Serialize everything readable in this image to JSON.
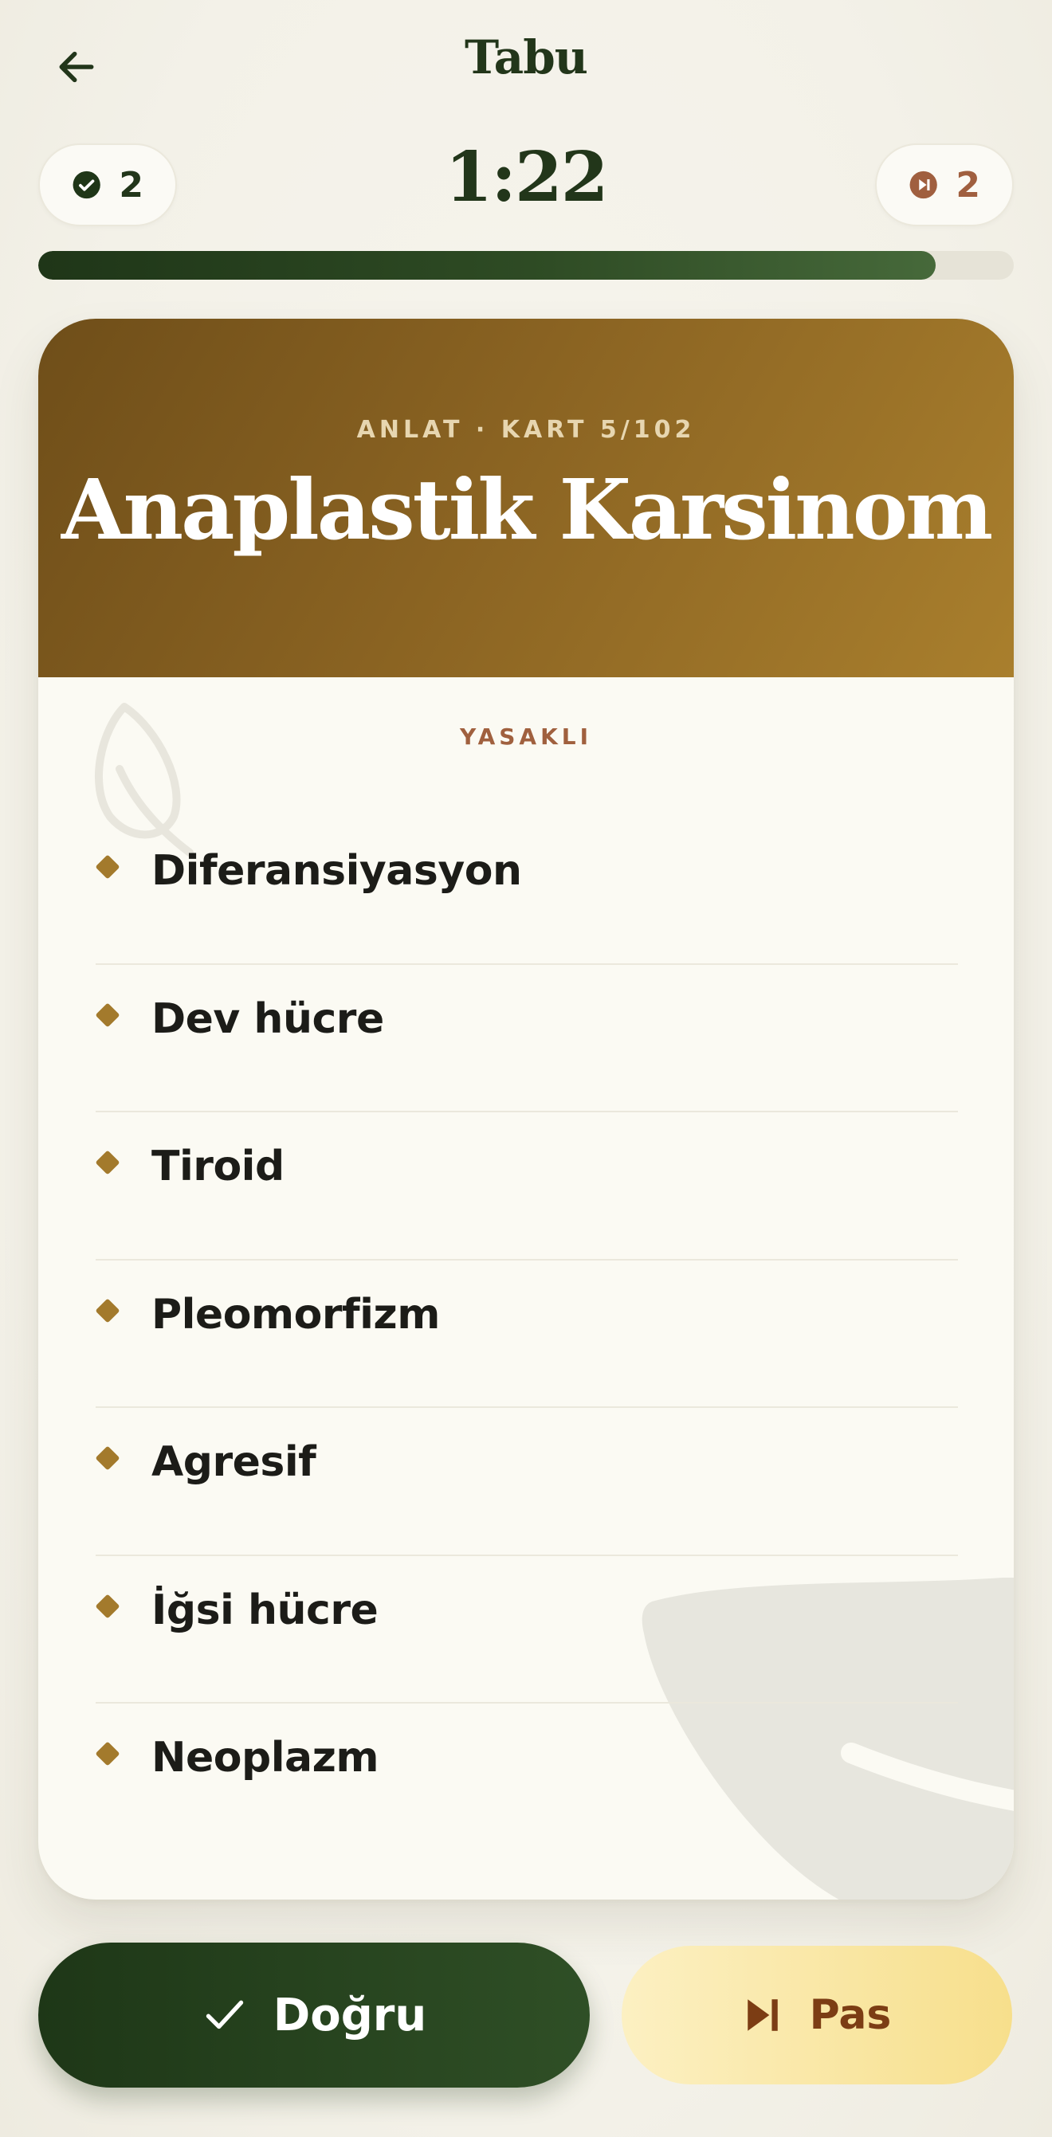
{
  "header": {
    "title": "Tabu",
    "timer": "1:22"
  },
  "score": {
    "correct_count": "2",
    "pass_count": "2"
  },
  "progress": {
    "fraction": 0.92
  },
  "card": {
    "subtitle": "ANLAT · KART 5/102",
    "word": "Anaplastik Karsinom",
    "taboo_label": "YASAKLI",
    "taboo_words": [
      "Diferansiyasyon",
      "Dev hücre",
      "Tiroid",
      "Pleomorfizm",
      "Agresif",
      "İğsi hücre",
      "Neoplazm"
    ]
  },
  "actions": {
    "correct_label": "Doğru",
    "pass_label": "Pas"
  },
  "colors": {
    "forest": "#22361a",
    "gold": "#a37a2c",
    "rust": "#a05f3f",
    "cream": "#fbfaf3"
  },
  "icons": [
    "back-arrow-icon",
    "check-circle-icon",
    "skip-circle-icon",
    "leaf-icon",
    "checkmark-icon",
    "skip-next-icon"
  ]
}
